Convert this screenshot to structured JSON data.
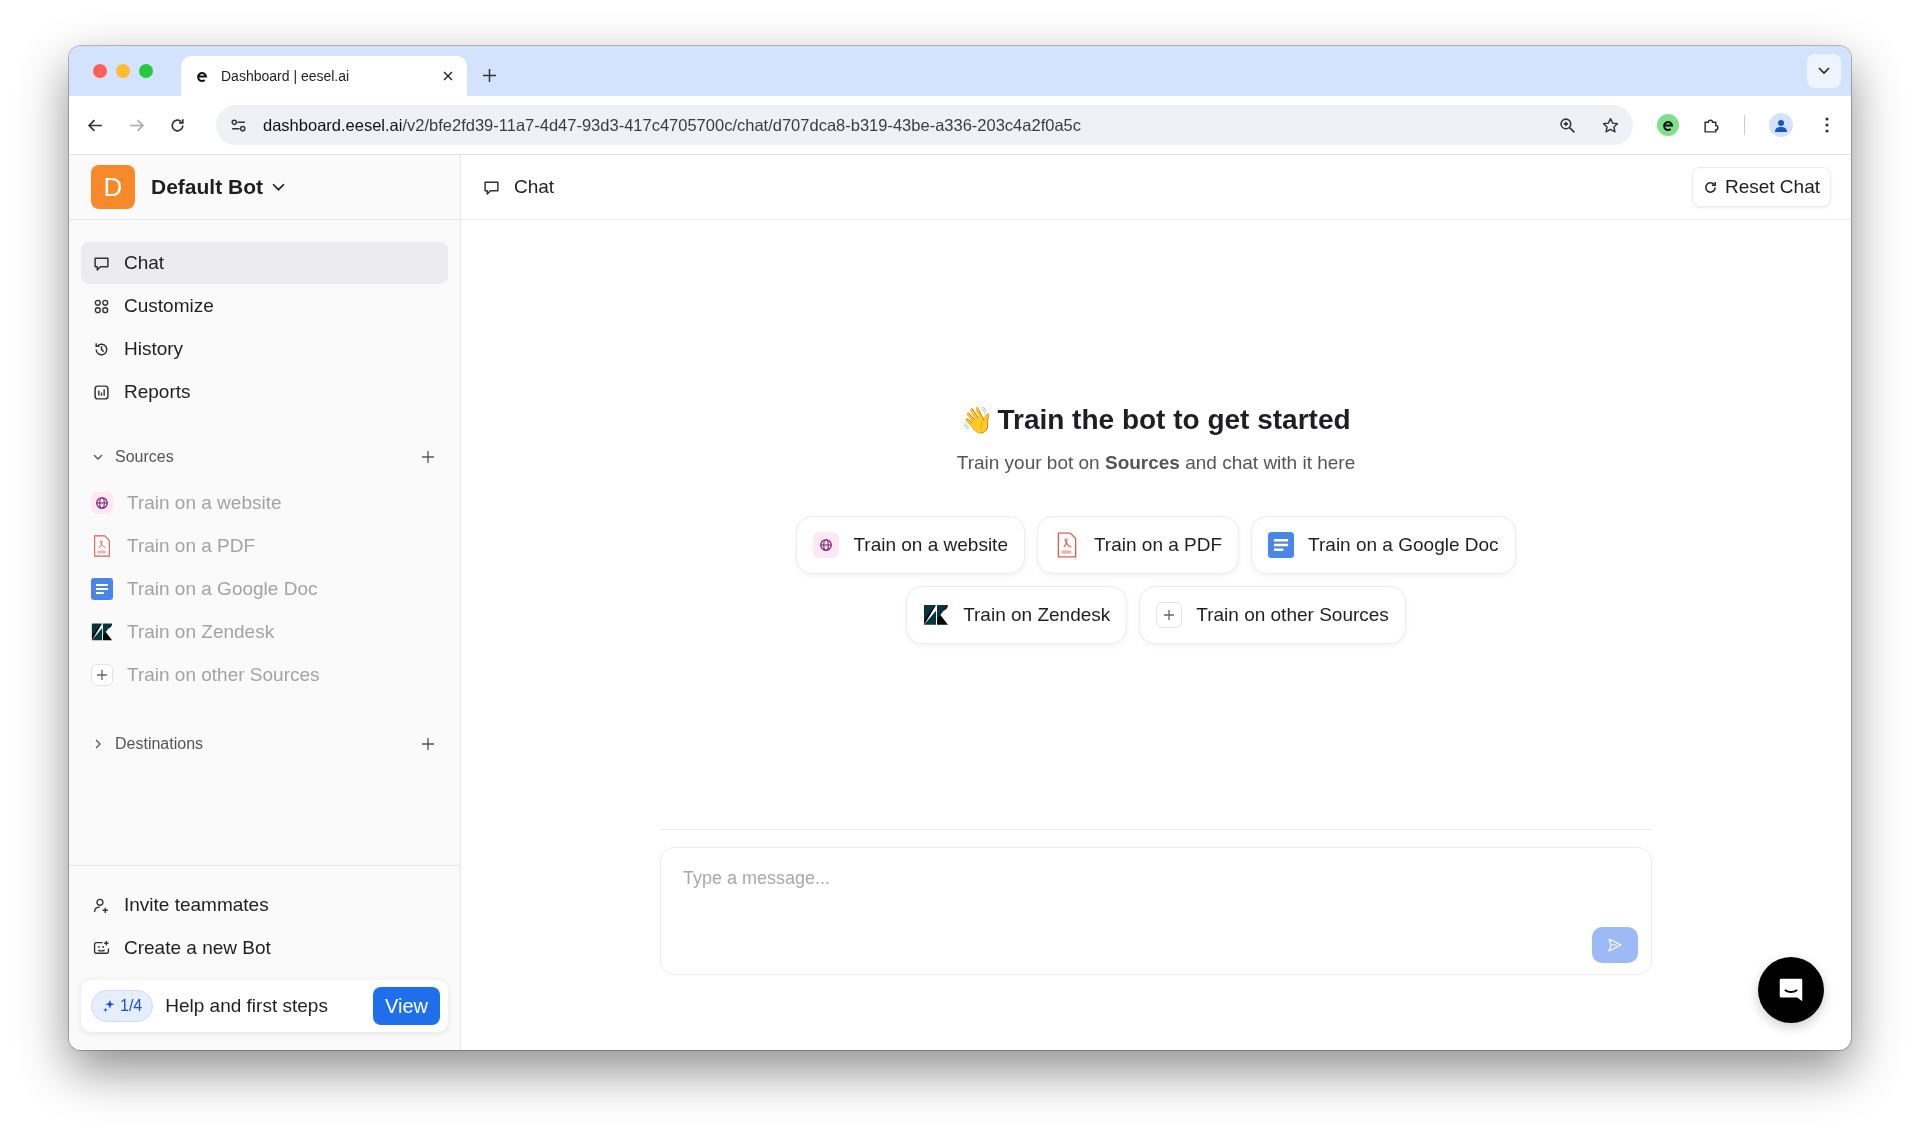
{
  "browser": {
    "tab_title": "Dashboard | eesel.ai",
    "url_host": "dashboard.eesel.ai",
    "url_path": "/v2/bfe2fd39-11a7-4d47-93d3-417c4705700c/chat/d707dca8-b319-43be-a336-203c4a2f0a5c"
  },
  "sidebar": {
    "bot_initial": "D",
    "bot_name": "Default Bot",
    "nav": [
      {
        "kind": "chat",
        "label": "Chat",
        "selected": true
      },
      {
        "kind": "customize",
        "label": "Customize",
        "selected": false
      },
      {
        "kind": "history",
        "label": "History",
        "selected": false
      },
      {
        "kind": "reports",
        "label": "Reports",
        "selected": false
      }
    ],
    "sections": [
      {
        "title": "Sources",
        "expanded": true,
        "items": [
          {
            "kind": "website",
            "label": "Train on a website",
            "disabled": true
          },
          {
            "kind": "pdf",
            "label": "Train on a PDF",
            "disabled": true
          },
          {
            "kind": "gdoc",
            "label": "Train on a Google Doc",
            "disabled": true
          },
          {
            "kind": "zendesk",
            "label": "Train on Zendesk",
            "disabled": true
          },
          {
            "kind": "other",
            "label": "Train on other Sources",
            "disabled": true
          }
        ]
      },
      {
        "title": "Destinations",
        "expanded": false
      }
    ],
    "footer": [
      {
        "kind": "invite",
        "label": "Invite teammates"
      },
      {
        "kind": "bot",
        "label": "Create a new Bot"
      }
    ],
    "help": {
      "progress": "1/4",
      "label": "Help and first steps",
      "button": "View"
    }
  },
  "main": {
    "title": "Chat",
    "reset_button": "Reset Chat",
    "emoji": "👋",
    "heading": "Train the bot to get started",
    "subtitle": "Train your bot on **Sources** and chat with it here",
    "chip_rows": [
      [
        {
          "kind": "website",
          "label": "Train on a website"
        },
        {
          "kind": "pdf",
          "label": "Train on a PDF"
        },
        {
          "kind": "gdoc",
          "label": "Train on a Google Doc"
        }
      ],
      [
        {
          "kind": "zendesk",
          "label": "Train on Zendesk"
        },
        {
          "kind": "other",
          "label": "Train on other Sources"
        }
      ]
    ],
    "message_placeholder": "Type a message..."
  }
}
